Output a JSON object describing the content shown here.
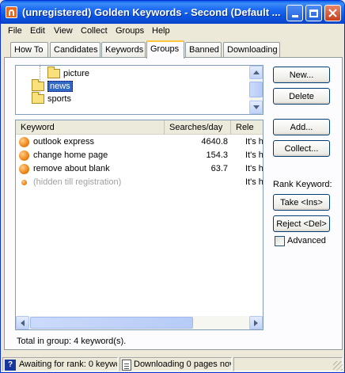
{
  "window": {
    "title": "(unregistered) Golden Keywords - Second (Default ..."
  },
  "menu": [
    "File",
    "Edit",
    "View",
    "Collect",
    "Groups",
    "Help"
  ],
  "tabs": [
    "How To",
    "Candidates",
    "Keywords",
    "Groups",
    "Banned",
    "Downloading"
  ],
  "active_tab": "Groups",
  "tree": {
    "items": [
      {
        "label": "picture"
      },
      {
        "label": "news",
        "selected": true
      },
      {
        "label": "sports"
      }
    ]
  },
  "group_buttons": {
    "new": "New...",
    "delete": "Delete"
  },
  "keyword_buttons": {
    "add": "Add...",
    "collect": "Collect..."
  },
  "list": {
    "columns": [
      "Keyword",
      "Searches/day",
      "Rele"
    ],
    "rows": [
      {
        "keyword": "outlook express",
        "searches": "4640.8",
        "relevance": "It's h"
      },
      {
        "keyword": "change home page",
        "searches": "154.3",
        "relevance": "It's h"
      },
      {
        "keyword": "remove about blank",
        "searches": "63.7",
        "relevance": "It's h"
      },
      {
        "keyword": "(hidden till registration)",
        "searches": "",
        "relevance": "It's h"
      }
    ]
  },
  "rank": {
    "label": "Rank Keyword:",
    "take": "Take  <Ins>",
    "reject": "Reject <Del>",
    "advanced": "Advanced",
    "advanced_checked": false
  },
  "total_text": "Total in group: 4 keyword(s).",
  "status": {
    "rank_text": "Awaiting for rank: 0 keywo",
    "download_text": "Downloading 0 pages nov"
  },
  "colors": {
    "titlebar": "#0b54e0",
    "selection": "#316ac5",
    "rank_dot": "#f08a1e",
    "active_tab_accent": "#ffc83c"
  }
}
